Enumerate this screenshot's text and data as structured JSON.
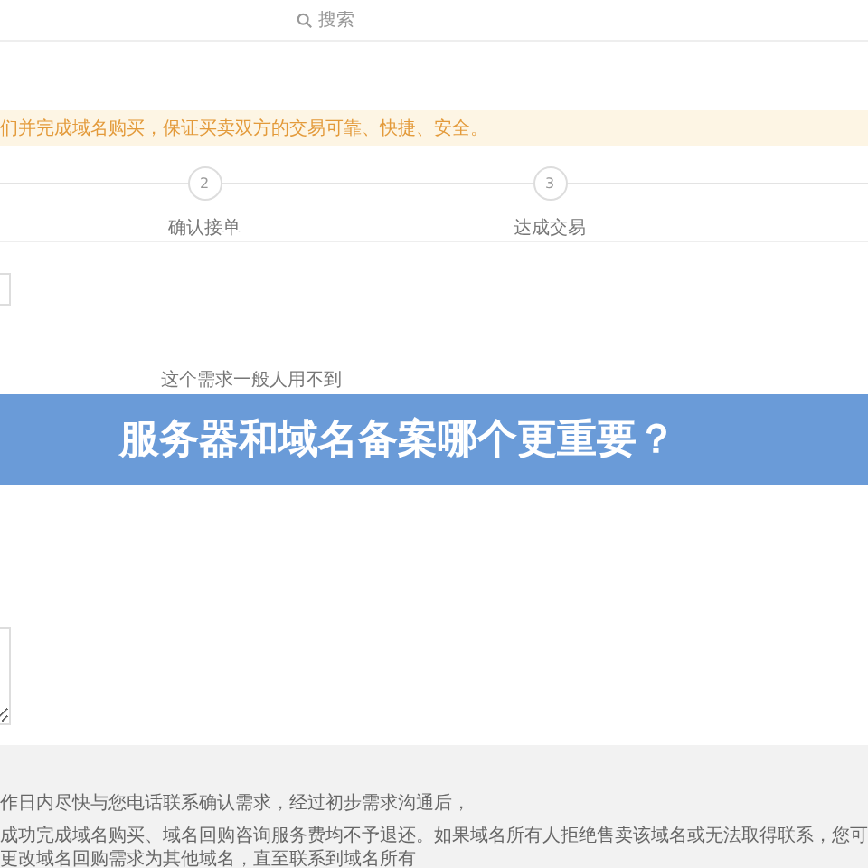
{
  "header": {
    "search": {
      "placeholder": "搜索"
    }
  },
  "notice": {
    "text": "们并完成域名购买，保证买卖双方的交易可靠、快捷、安全。"
  },
  "steps": [
    {
      "number": "2",
      "label": "确认接单"
    },
    {
      "number": "3",
      "label": "达成交易"
    }
  ],
  "form": {
    "hint": "这个需求一般人用不到"
  },
  "banner": {
    "title": "服务器和域名备案哪个更重要？"
  },
  "footer": {
    "lines": [
      "作日内尽快与您电话联系确认需求，经过初步需求沟通后，",
      "成功完成域名购买、域名回购咨询服务费均不予退还。如果域名所有人拒绝售卖该域名或无法取得联系，您可更改域名回购需求为其他域名，直至联系到域名所有"
    ]
  }
}
